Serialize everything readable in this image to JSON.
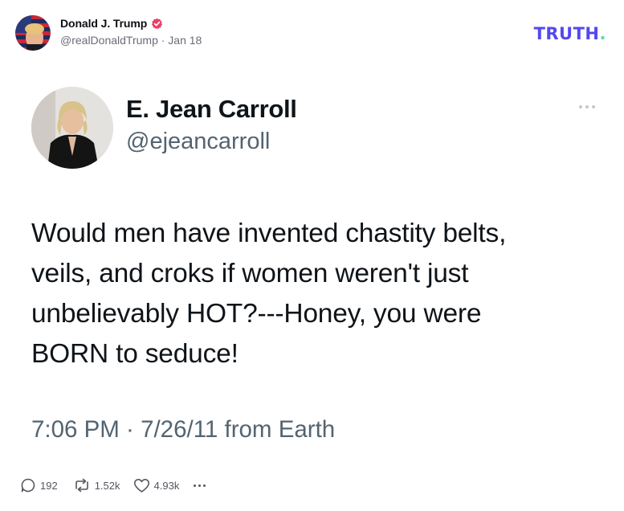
{
  "post": {
    "author_name": "Donald J. Trump",
    "author_handle": "@realDonaldTrump",
    "separator": "·",
    "date": "Jan 18",
    "meta": "@realDonaldTrump · Jan 18",
    "verified_icon": "verified-badge-icon",
    "badge_color": "#e8406b"
  },
  "brand": {
    "logo_text": "TRUTH",
    "logo_dot": ".",
    "logo_color": "#5448ee",
    "dot_color": "#5ad7b0"
  },
  "tweet": {
    "author_name": "E. Jean Carroll",
    "handle": "@ejeancarroll",
    "text_lines": [
      "Would men have invented chastity belts,",
      "veils, and croks if women weren't just",
      "unbelievably HOT?---Honey, you were",
      "BORN to seduce!"
    ],
    "timestamp": "7:06 PM · 7/26/11 from Earth",
    "more_icon": "more-options-icon"
  },
  "actions": {
    "reply_count": "192",
    "retruth_count": "1.52k",
    "like_count": "4.93k",
    "reply_icon": "reply-icon",
    "retruth_icon": "retruth-icon",
    "like_icon": "heart-icon",
    "more_icon": "more-icon"
  }
}
